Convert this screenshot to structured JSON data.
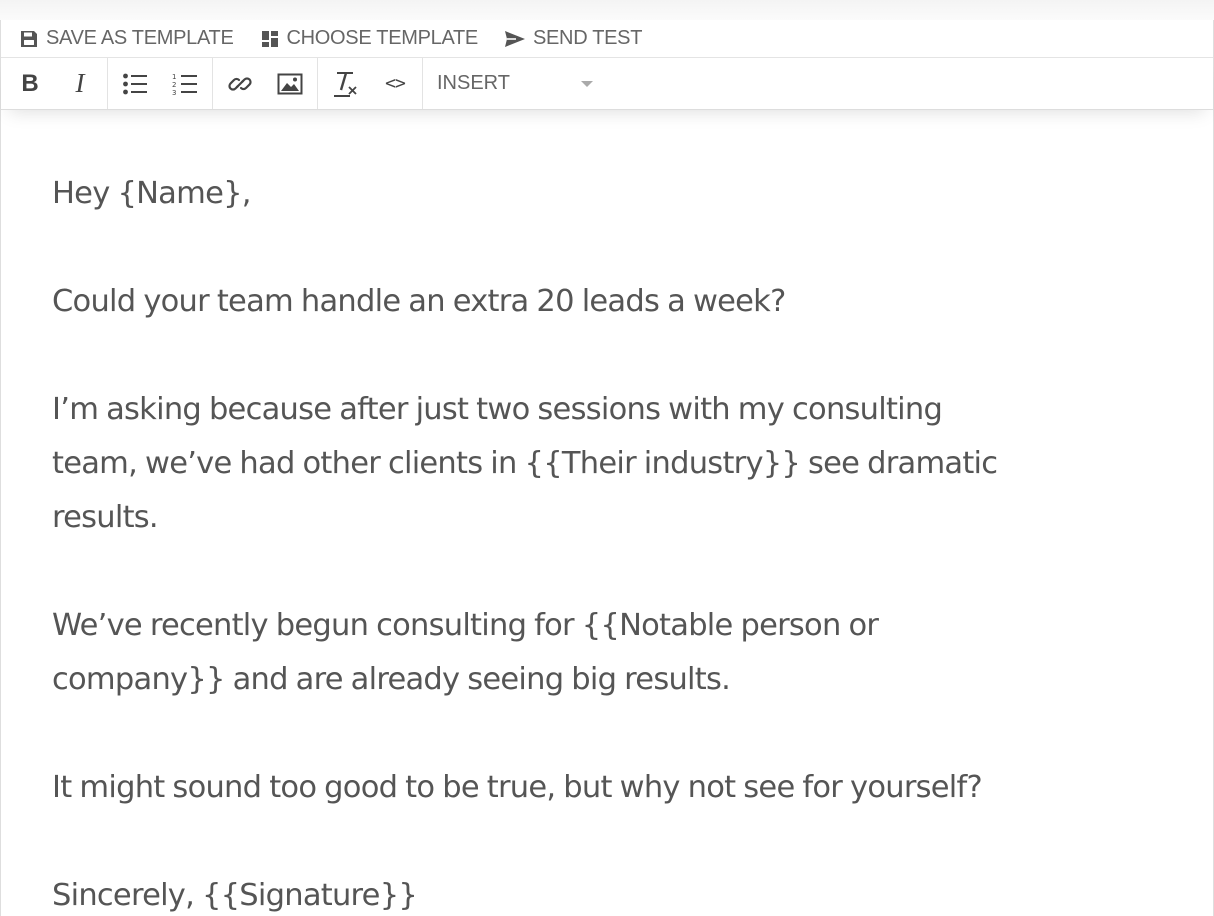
{
  "action_bar": {
    "save_template": "SAVE AS TEMPLATE",
    "choose_template": "CHOOSE TEMPLATE",
    "send_test": "SEND TEST"
  },
  "format_bar": {
    "insert_label": "INSERT",
    "icons": [
      "bold-icon",
      "italic-icon",
      "bullet-list-icon",
      "numbered-list-icon",
      "link-icon",
      "image-icon",
      "clear-format-icon",
      "code-icon",
      "chevron-down-icon"
    ]
  },
  "email": {
    "lines": [
      "Hey {Name},",
      "Could your team handle an extra 20 leads a week?",
      "I’m asking because after just two sessions with my consulting",
      "team, we’ve had other clients in {{Their industry}} see dramatic",
      "results.",
      "We’ve recently begun consulting for {{Notable person or",
      "company}} and are already seeing big results.",
      "It might sound too good to be true, but why not see for yourself?",
      "Sincerely, {{Signature}}"
    ]
  },
  "colors": {
    "text": "#555555",
    "toolbar_text": "#666666",
    "icon": "#444444",
    "border": "#dddddd"
  }
}
